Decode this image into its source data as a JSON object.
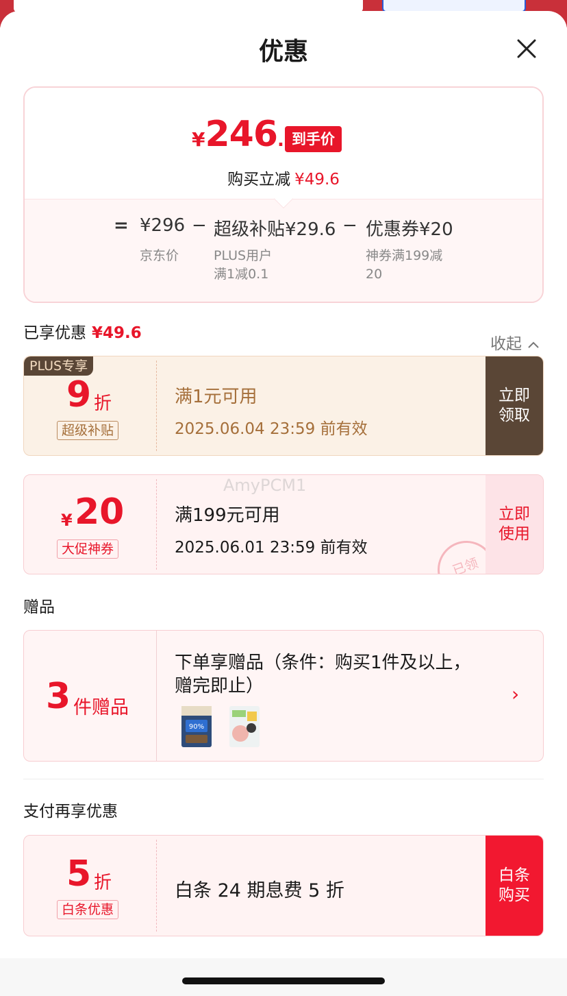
{
  "header": {
    "title": "优惠"
  },
  "summary": {
    "yen_symbol": "¥",
    "final_int": "246",
    "final_dec": ".4",
    "final_tag": "到手价",
    "instant_label": "购买立减",
    "instant_value": "¥49.6",
    "formula": {
      "eq": "=",
      "minus": "−",
      "jd_price": "¥296",
      "jd_label": "京东价",
      "subsidy": "超级补贴¥29.6",
      "subsidy_note_1": "PLUS用户",
      "subsidy_note_2": "满1减0.1",
      "coupon": "优惠券¥20",
      "coupon_note_1": "神券满199减",
      "coupon_note_2": "20"
    }
  },
  "enjoyed": {
    "label": "已享优惠",
    "value": "¥49.6",
    "collapse": "收起"
  },
  "coupons": [
    {
      "badge": "PLUS专享",
      "num": "9",
      "unit": "折",
      "tag": "超级补贴",
      "title": "满1元可用",
      "expiry": "2025.06.04 23:59 前有效",
      "action_1": "立即",
      "action_2": "领取"
    },
    {
      "yen": "¥",
      "num": "20",
      "tag": "大促神券",
      "title": "满199元可用",
      "expiry": "2025.06.01 23:59 前有效",
      "action_1": "立即",
      "action_2": "使用",
      "stamp": "已领"
    }
  ],
  "gifts": {
    "section": "赠品",
    "num": "3",
    "unit": "件赠品",
    "desc_1": "下单享赠品（条件：购买1件及以上，",
    "desc_2": "赠完即止）",
    "items": [
      {
        "name": "gift-pet-food-bag",
        "color": "#2e4c7a",
        "label": "90%"
      },
      {
        "name": "gift-pet-treat-pack",
        "color": "#e9eef0",
        "label": ""
      }
    ]
  },
  "payment": {
    "section": "支付再享优惠",
    "num": "5",
    "unit": "折",
    "tag": "白条优惠",
    "title": "白条 24 期息费 5 折",
    "action_1": "白条",
    "action_2": "购买"
  },
  "watermark": "AmyPCM1",
  "colors": {
    "red": "#e8162a",
    "brown": "#5a4636",
    "gold": "#a56f3a"
  }
}
